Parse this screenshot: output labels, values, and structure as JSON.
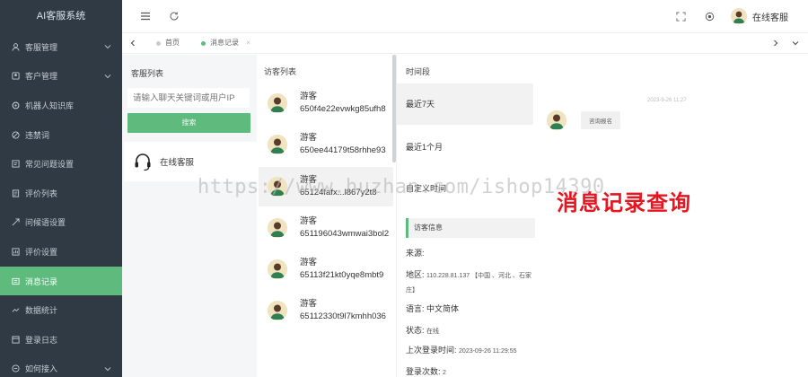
{
  "app": {
    "title": "AI客服系统"
  },
  "sidebar": {
    "items": [
      {
        "label": "客服管理",
        "icon": "user-icon",
        "has_children": true
      },
      {
        "label": "客户管理",
        "icon": "user-group-icon",
        "has_children": true
      },
      {
        "label": "机器人知识库",
        "icon": "robot-icon",
        "has_children": false
      },
      {
        "label": "违禁词",
        "icon": "block-icon",
        "has_children": false
      },
      {
        "label": "常见问题设置",
        "icon": "faq-icon",
        "has_children": false
      },
      {
        "label": "评价列表",
        "icon": "rating-list-icon",
        "has_children": false
      },
      {
        "label": "问候语设置",
        "icon": "greeting-icon",
        "has_children": false
      },
      {
        "label": "评价设置",
        "icon": "rating-settings-icon",
        "has_children": false
      },
      {
        "label": "消息记录",
        "icon": "message-icon",
        "has_children": false,
        "active": true
      },
      {
        "label": "数据统计",
        "icon": "stats-icon",
        "has_children": false
      },
      {
        "label": "登录日志",
        "icon": "log-icon",
        "has_children": false
      },
      {
        "label": "如何接入",
        "icon": "link-icon",
        "has_children": true
      }
    ]
  },
  "header": {
    "user_name": "在线客服",
    "icons": [
      "menu-icon",
      "refresh-icon",
      "fullscreen-icon",
      "theme-icon"
    ]
  },
  "tabs": [
    {
      "label": "首页",
      "active": false
    },
    {
      "label": "消息记录",
      "active": true,
      "close": "×"
    }
  ],
  "panel_service": {
    "title": "客服列表",
    "search_placeholder": "请输入聊天关键词或用户IP",
    "search_button": "搜索",
    "service_name": "在线客服"
  },
  "panel_visitors": {
    "title": "访客列表",
    "items": [
      {
        "name": "游客",
        "id": "650f4e22evwkg85ufh8"
      },
      {
        "name": "游客",
        "id": "650ee44179t58rhhe93"
      },
      {
        "name": "游客",
        "id": "65124fafx...l867y2t8",
        "selected": true
      },
      {
        "name": "游客",
        "id": "651196043wmwai3bol2"
      },
      {
        "name": "游客",
        "id": "65113f21kt0yqe8mbt9"
      },
      {
        "name": "游客",
        "id": "65112330t9l7kmhh036"
      }
    ]
  },
  "panel_time": {
    "title": "时间段",
    "periods": [
      {
        "label": "最近7天",
        "selected": true
      },
      {
        "label": "最近1个月",
        "selected": false
      },
      {
        "label": "自定义时间",
        "selected": false
      }
    ],
    "info_title": "访客信息",
    "source_label": "来源:",
    "region_label": "地区:",
    "region_value": "110.228.81.137 【中国 、河北 、石家庄】",
    "language_label": "语言:",
    "language_value": "中文简体",
    "status_label": "状态:",
    "status_value": "在线",
    "last_login_label": "上次登录时间:",
    "last_login_value": "2023-09-26 11:29:55",
    "login_count_label": "登录次数:",
    "login_count_value": "2"
  },
  "panel_messages": {
    "time": "2023-9-26 11:27",
    "messages": [
      {
        "text": "咨询报名"
      }
    ]
  },
  "overlays": {
    "watermark": "https://www.huzhan.com/ishop14390",
    "promo_text": "消息记录查询"
  },
  "colors": {
    "sidebar_bg": "#2f3a44",
    "accent": "#5fba7d",
    "promo": "#e8141f"
  }
}
